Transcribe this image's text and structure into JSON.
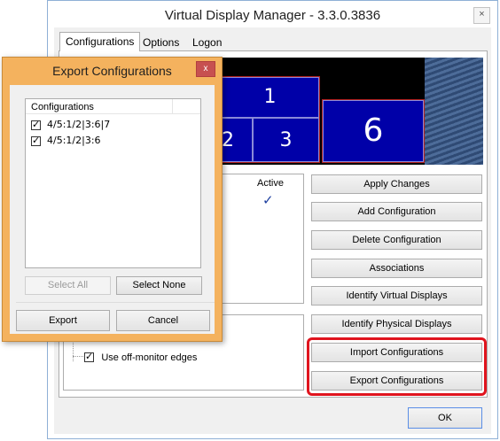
{
  "main": {
    "title": "Virtual Display Manager - 3.3.0.3836",
    "close_glyph": "×",
    "tabs": [
      {
        "label": "Configurations",
        "active": true
      },
      {
        "label": "Options",
        "active": false
      },
      {
        "label": "Logon",
        "active": false
      }
    ],
    "preview": {
      "monitors": [
        "1",
        "2",
        "3",
        "6"
      ]
    },
    "config_list": {
      "columns": [
        "",
        "Active"
      ],
      "active_mark": "✓"
    },
    "options": {
      "off_monitor_edges": {
        "label": "Use off-monitor edges",
        "checked": true
      }
    },
    "buttons": {
      "apply": "Apply Changes",
      "add": "Add Configuration",
      "delete": "Delete Configuration",
      "associations": "Associations",
      "identify_virtual": "Identify Virtual Displays",
      "identify_physical": "Identify Physical Displays",
      "import": "Import Configurations",
      "export": "Export Configurations",
      "ok": "OK"
    },
    "highlight_color": "#e0141e"
  },
  "dialog": {
    "title": "Export Configurations",
    "close_glyph": "x",
    "list_header": "Configurations",
    "items": [
      {
        "label": "4/5:1/2|3:6|7",
        "checked": true
      },
      {
        "label": "4/5:1/2|3:6",
        "checked": true
      }
    ],
    "select_all": "Select All",
    "select_none": "Select None",
    "export": "Export",
    "cancel": "Cancel",
    "frame_color": "#f4b25e"
  }
}
